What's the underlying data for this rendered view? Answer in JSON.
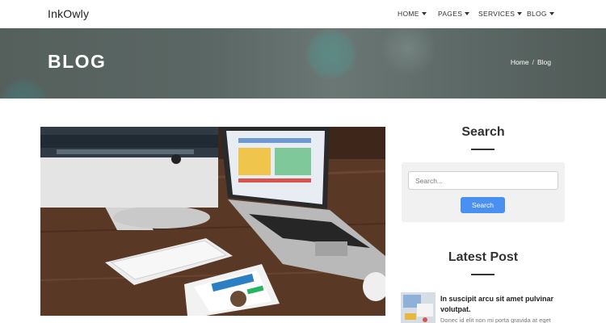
{
  "brand": "InkOwly",
  "nav": [
    {
      "label": "HOME"
    },
    {
      "label": "PAGES"
    },
    {
      "label": "SERVICES"
    },
    {
      "label": "BLOG"
    }
  ],
  "hero": {
    "title": "BLOG",
    "breadcrumb": {
      "home": "Home",
      "separator": "/",
      "current": "Blog"
    }
  },
  "sidebar": {
    "search": {
      "title": "Search",
      "placeholder": "Search...",
      "button_label": "Search"
    },
    "latest": {
      "title": "Latest Post",
      "posts": [
        {
          "title": "In suscipit arcu sit amet pulvinar volutpat.",
          "excerpt": "Donec id elit non mi porta gravida at eget"
        }
      ]
    }
  },
  "colors": {
    "accent": "#4a90f0",
    "hero_overlay": "#5b6764",
    "search_panel": "#f1f1f1"
  }
}
